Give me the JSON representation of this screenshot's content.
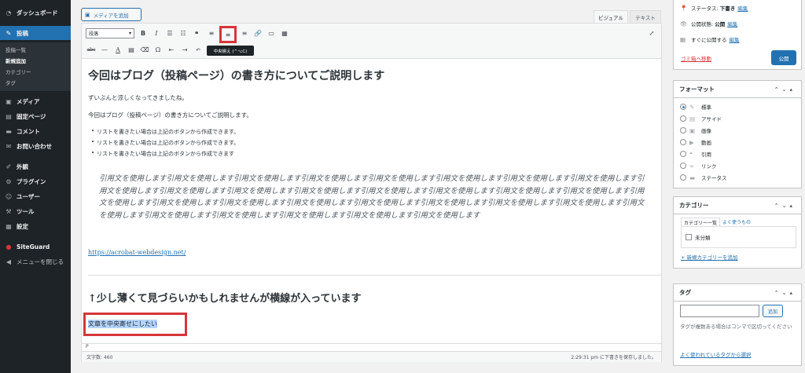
{
  "sidebar": {
    "items": [
      {
        "label": "ダッシュボード",
        "icon": "dashboard-icon"
      },
      {
        "label": "投稿",
        "icon": "pin-icon"
      },
      {
        "label": "メディア",
        "icon": "media-icon"
      },
      {
        "label": "固定ページ",
        "icon": "page-icon"
      },
      {
        "label": "コメント",
        "icon": "comment-icon"
      },
      {
        "label": "お問い合わせ",
        "icon": "mail-icon"
      },
      {
        "label": "外観",
        "icon": "brush-icon"
      },
      {
        "label": "プラグイン",
        "icon": "plugin-icon"
      },
      {
        "label": "ユーザー",
        "icon": "user-icon"
      },
      {
        "label": "ツール",
        "icon": "wrench-icon"
      },
      {
        "label": "設定",
        "icon": "settings-icon"
      },
      {
        "label": "SiteGuard",
        "icon": "siteguard-icon"
      },
      {
        "label": "メニューを閉じる",
        "icon": "collapse-icon"
      }
    ],
    "submenu": [
      "投稿一覧",
      "新規追加",
      "カテゴリー",
      "タグ"
    ]
  },
  "editor": {
    "add_media": "メディアを追加",
    "tab_visual": "ビジュアル",
    "tab_text": "テキスト",
    "format_select": "段落",
    "tooltip": "中央揃え (^⌥C)",
    "title": "今回はブログ（投稿ページ）の書き方についてご説明します",
    "para1": "ずいぶんと涼しくなってきましたね。",
    "para2": "今回はブログ（投稿ページ）の書き方についてご説明します。",
    "list": [
      "リストを書きたい場合は上記のボタンから作成できます。",
      "リストを書きたい場合は上記のボタンから作成できます。",
      "リストを書きたい場合は上記のボタンから作成できます"
    ],
    "quote": "引用文を使用します引用文を使用します引用文を使用します引用文を使用します引用文を使用します引用文を使用します引用文を使用します引用文を使用します引用文を使用します引用文を使用します引用文を使用します引用文を使用します引用文を使用します引用文を使用します引用文を使用します引用文を使用します引用文を使用します引用文を使用します引用文を使用します引用文を使用します引用文を使用します引用文を使用します引用文を使用します引用文を使用します引用文を使用します引用文を使用します引用文を使用します引用文を使用します引用文を使用します引用文を使用します",
    "link": "https://acrobat-webdesign.net/",
    "heading2": "↑少し薄くて見づらいかもしれませんが横線が入っています",
    "selected_text": "文章を中央寄せにしたい",
    "path": "P",
    "word_count": "文字数: 460",
    "save_status": "2:29:31 pm に下書きを保存しました。"
  },
  "publish": {
    "status_label": "ステータス:",
    "status_value": "下書き",
    "visibility_label": "公開状態:",
    "visibility_value": "公開",
    "schedule_label": "すぐに公開する",
    "edit": "編集",
    "trash": "ゴミ箱へ移動",
    "publish_button": "公開"
  },
  "format_box": {
    "title": "フォーマット",
    "options": [
      {
        "label": "標準",
        "icon": "pin-icon"
      },
      {
        "label": "アサイド",
        "icon": "aside-icon"
      },
      {
        "label": "画像",
        "icon": "image-icon"
      },
      {
        "label": "動画",
        "icon": "video-icon"
      },
      {
        "label": "引用",
        "icon": "quote-icon"
      },
      {
        "label": "リンク",
        "icon": "link-icon"
      },
      {
        "label": "ステータス",
        "icon": "status-icon"
      }
    ]
  },
  "category_box": {
    "title": "カテゴリー",
    "tab_all": "カテゴリー一覧",
    "tab_popular": "よく使うもの",
    "item": "未分類",
    "add_new": "+ 新規カテゴリーを追加"
  },
  "tag_box": {
    "title": "タグ",
    "add_button": "追加",
    "help": "タグが複数ある場合はコンマで区切ってください",
    "popular_link": "よく使われているタグから選択"
  },
  "colors": {
    "sidebar": "#1d2327",
    "accent": "#2271b1",
    "highlight": "#d63638"
  }
}
